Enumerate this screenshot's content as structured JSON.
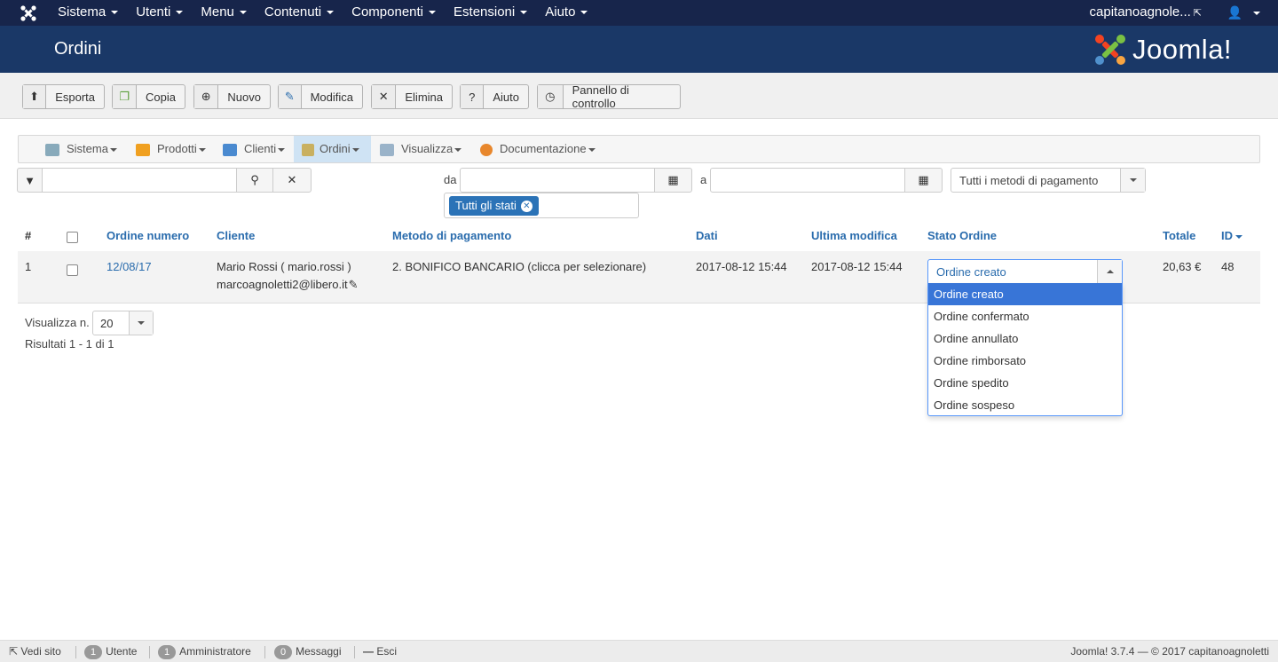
{
  "topnav": {
    "menu": [
      "Sistema",
      "Utenti",
      "Menu",
      "Contenuti",
      "Componenti",
      "Estensioni",
      "Aiuto"
    ],
    "user": "capitanoagnole..."
  },
  "header": {
    "title": "Ordini",
    "brand": "Joomla!"
  },
  "toolbar": {
    "export": "Esporta",
    "copy": "Copia",
    "new": "Nuovo",
    "edit": "Modifica",
    "delete": "Elimina",
    "help": "Aiuto",
    "control_panel": "Pannello di controllo"
  },
  "submenu": [
    "Sistema",
    "Prodotti",
    "Clienti",
    "Ordini",
    "Visualizza",
    "Documentazione"
  ],
  "filters": {
    "search_value": "",
    "from_label": "da",
    "to_label": "a",
    "payment_method": "Tutti i metodi di pagamento",
    "status_chip": "Tutti gli stati"
  },
  "table": {
    "headers": {
      "num": "#",
      "order_number": "Ordine numero",
      "customer": "Cliente",
      "payment": "Metodo di pagamento",
      "date": "Dati",
      "last_modified": "Ultima modifica",
      "status": "Stato Ordine",
      "total": "Totale",
      "id": "ID"
    },
    "rows": [
      {
        "num": "1",
        "order_number": "12/08/17",
        "customer_name": "Mario Rossi ( mario.rossi )",
        "customer_email": "marcoagnoletti2@libero.it",
        "payment": "2. BONIFICO BANCARIO (clicca per selezionare)",
        "date": "2017-08-12 15:44",
        "last_modified": "2017-08-12 15:44",
        "status": "Ordine creato",
        "total": "20,63 €",
        "id": "48"
      }
    ]
  },
  "status_options": [
    "Ordine creato",
    "Ordine confermato",
    "Ordine annullato",
    "Ordine rimborsato",
    "Ordine spedito",
    "Ordine sospeso"
  ],
  "pagination": {
    "label": "Visualizza n.",
    "value": "20",
    "results": "Risultati 1 - 1 di 1"
  },
  "footer": {
    "view_site": "Vedi sito",
    "users_count": "1",
    "users_label": "Utente",
    "admins_count": "1",
    "admins_label": "Amministratore",
    "messages_count": "0",
    "messages_label": "Messaggi",
    "logout": "Esci",
    "version": "Joomla! 3.7.4",
    "copyright": "— © 2017 capitanoagnoletti"
  },
  "colors": {
    "navbar": "#17254b",
    "header": "#1a3867",
    "link": "#2a6cad",
    "highlight": "#3875d7"
  }
}
